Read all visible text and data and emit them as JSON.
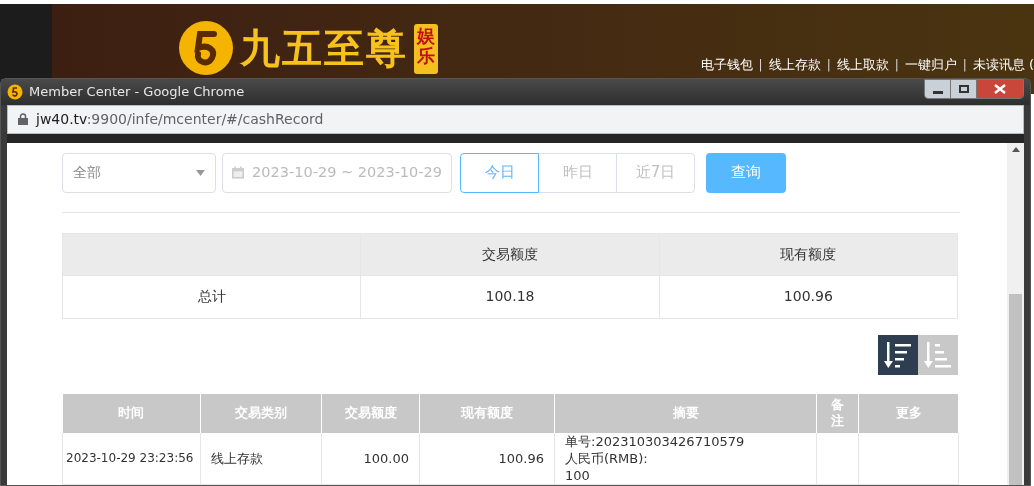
{
  "site": {
    "brand": "九五至尊",
    "badge": "娱乐",
    "nav": [
      {
        "kind": "link",
        "text": "电子钱包"
      },
      {
        "kind": "separator",
        "text": "|"
      },
      {
        "kind": "link",
        "text": "线上存款"
      },
      {
        "kind": "separator",
        "text": "|"
      },
      {
        "kind": "link",
        "text": "线上取款"
      },
      {
        "kind": "separator",
        "text": "|"
      },
      {
        "kind": "link",
        "text": "一键归户"
      },
      {
        "kind": "separator",
        "text": "|"
      },
      {
        "kind": "link",
        "text": "未读讯息 ("
      }
    ]
  },
  "window": {
    "title": "Member Center - Google Chrome",
    "url_host": "jw40.tv",
    "url_rest": ":9900/infe/mcenter/#/cashRecord"
  },
  "filters": {
    "type_select": "全部",
    "date_range": "2023-10-29 ~ 2023-10-29",
    "ranges": [
      {
        "label": "今日",
        "selected": true
      },
      {
        "label": "昨日",
        "selected": false
      },
      {
        "label": "近7日",
        "selected": false
      }
    ],
    "query_button": "查询"
  },
  "summary": {
    "columns": [
      "",
      "交易额度",
      "现有额度"
    ],
    "row": [
      "总计",
      "100.18",
      "100.96"
    ]
  },
  "sort_buttons": [
    {
      "kind": "desc",
      "selected": true
    },
    {
      "kind": "asc",
      "selected": false
    }
  ],
  "records": {
    "columns": [
      "时间",
      "交易类别",
      "交易额度",
      "现有额度",
      "摘要",
      "备注",
      "更多"
    ],
    "rows": [
      {
        "time": "2023-10-29 23:23:56",
        "type": "线上存款",
        "amount": "100.00",
        "balance": "100.96",
        "summary": [
          "单号:202310303426710579",
          "人民币(RMB):",
          "100"
        ]
      }
    ]
  }
}
